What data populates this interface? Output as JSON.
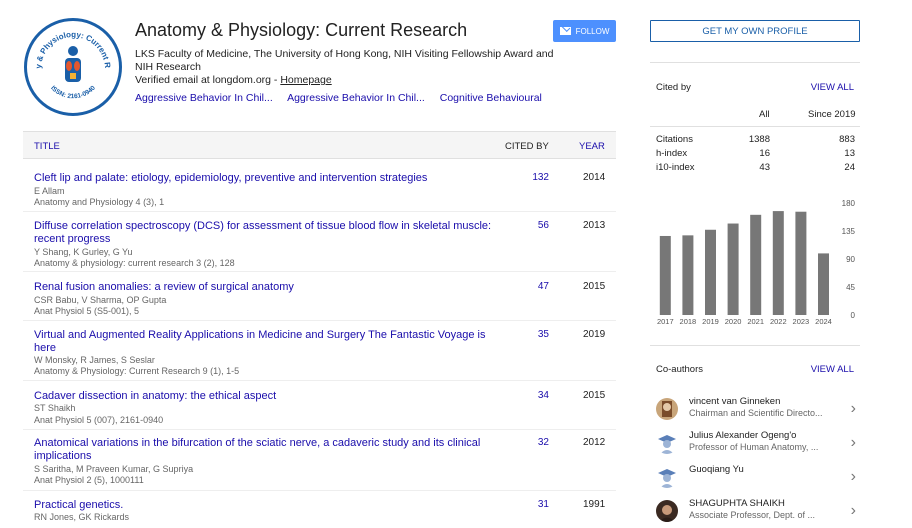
{
  "profile": {
    "name": "Anatomy & Physiology: Current Research",
    "affiliation": "LKS Faculty of Medicine, The University of Hong Kong, NIH Visiting Fellowship Award and NIH Research",
    "email_text": "Verified email at longdom.org - ",
    "homepage_label": "Homepage",
    "interests": [
      "Aggressive Behavior In Chil...",
      "Aggressive Behavior In Chil...",
      "Cognitive Behavioural"
    ],
    "logo_text_top": "Anatomy & Physiology: Current Research",
    "logo_text_bottom": "ISSN: 2161-0940",
    "follow_label": "FOLLOW"
  },
  "table": {
    "col_title": "TITLE",
    "col_cited": "CITED BY",
    "col_year": "YEAR",
    "rows": [
      {
        "title": "Cleft lip and palate: etiology, epidemiology, preventive and intervention strategies",
        "authors": "E Allam",
        "venue": "Anatomy and Physiology 4 (3), 1",
        "cited": "132",
        "year": "2014"
      },
      {
        "title": "Diffuse correlation spectroscopy (DCS) for assessment of tissue blood flow in skeletal muscle: recent progress",
        "authors": "Y Shang, K Gurley, G Yu",
        "venue": "Anatomy & physiology: current research 3 (2), 128",
        "cited": "56",
        "year": "2013"
      },
      {
        "title": "Renal fusion anomalies: a review of surgical anatomy",
        "authors": "CSR Babu, V Sharma, OP Gupta",
        "venue": "Anat Physiol 5 (S5-001), 5",
        "cited": "47",
        "year": "2015"
      },
      {
        "title": "Virtual and Augmented Reality Applications in Medicine and Surgery The Fantastic Voyage is here",
        "authors": "W Monsky, R James, S Seslar",
        "venue": "Anatomy & Physiology: Current Research 9 (1), 1-5",
        "cited": "35",
        "year": "2019"
      },
      {
        "title": "Cadaver dissection in anatomy: the ethical aspect",
        "authors": "ST Shaikh",
        "venue": "Anat Physiol 5 (007), 2161-0940",
        "cited": "34",
        "year": "2015"
      },
      {
        "title": "Anatomical variations in the bifurcation of the sciatic nerve, a cadaveric study and its clinical implications",
        "authors": "S Saritha, M Praveen Kumar, G Supriya",
        "venue": "Anat Physiol 2 (5), 1000111",
        "cited": "32",
        "year": "2012"
      },
      {
        "title": "Practical genetics.",
        "authors": "RN Jones, GK Rickards",
        "venue": "",
        "cited": "31",
        "year": "1991"
      }
    ]
  },
  "sidebar": {
    "profile_button": "GET MY OWN PROFILE",
    "cited_by": "Cited by",
    "view_all": "VIEW ALL",
    "col_all": "All",
    "col_since": "Since 2019",
    "stats": [
      {
        "label": "Citations",
        "all": "1388",
        "since": "883"
      },
      {
        "label": "h-index",
        "all": "16",
        "since": "13"
      },
      {
        "label": "i10-index",
        "all": "43",
        "since": "24"
      }
    ],
    "coauthors_title": "Co-authors",
    "coauthors_view_all": "VIEW ALL",
    "coauthors": [
      {
        "name": "vincent van Ginneken",
        "affiliation": "Chairman and Scientific Directo..."
      },
      {
        "name": "Julius Alexander Ogeng'o",
        "affiliation": "Professor of Human Anatomy, ..."
      },
      {
        "name": "Guoqiang Yu",
        "affiliation": ""
      },
      {
        "name": "SHAGUPHTA SHAIKH",
        "affiliation": "Associate Professor, Dept. of ..."
      }
    ]
  },
  "chart_data": {
    "type": "bar",
    "categories": [
      "2017",
      "2018",
      "2019",
      "2020",
      "2021",
      "2022",
      "2023",
      "2024"
    ],
    "values": [
      127,
      128,
      137,
      147,
      161,
      167,
      166,
      99
    ],
    "yticks": [
      "180",
      "135",
      "90",
      "45",
      "0"
    ],
    "ylim": [
      0,
      180
    ],
    "bar_color": "#777777"
  }
}
